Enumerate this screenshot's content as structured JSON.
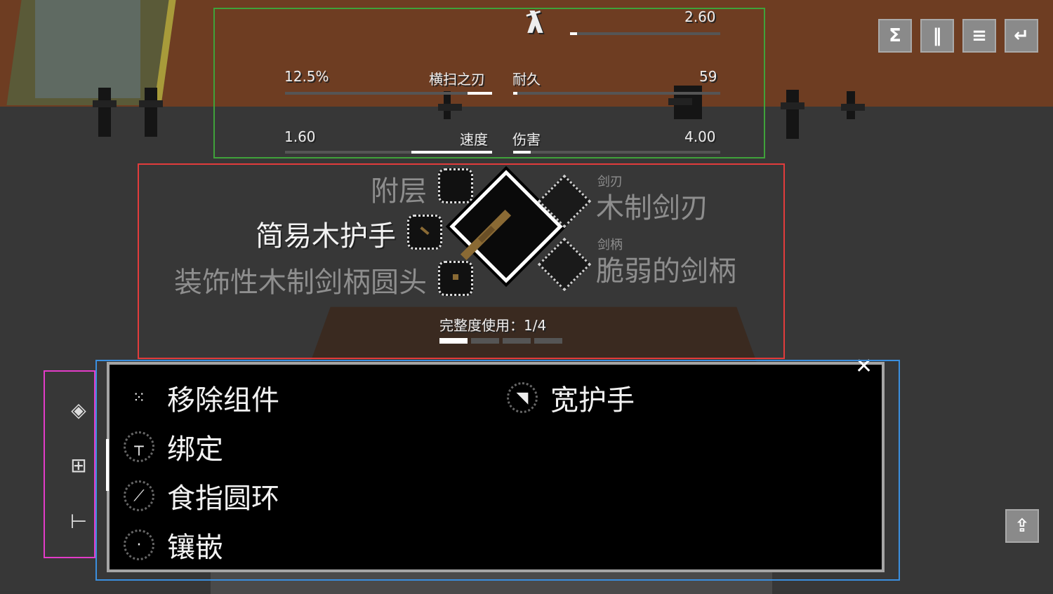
{
  "stats": {
    "top_value": "2.60",
    "sweep_percent": "12.5%",
    "sweep_label": "横扫之刃",
    "durability_label": "耐久",
    "durability_value": "59",
    "speed_value": "1.60",
    "speed_label": "速度",
    "damage_label": "伤害",
    "damage_value": "4.00"
  },
  "toolbar": {
    "icons": [
      "sort-icon",
      "pause-icon",
      "menu-icon",
      "return-icon"
    ],
    "glyphs": [
      "Σ",
      "‖",
      "≡",
      "↵"
    ]
  },
  "parts": {
    "layer_label": "附层",
    "guard_label": "简易木护手",
    "pommel_label": "装饰性木制剑柄圆头",
    "blade_category": "剑刃",
    "blade_label": "木制剑刃",
    "handle_category": "剑柄",
    "handle_label": "脆弱的剑柄",
    "integrity_text": "完整度使用：1/4",
    "integrity_used": 1,
    "integrity_total": 4
  },
  "options": {
    "remove": "移除组件",
    "wide_guard": "宽护手",
    "bind": "绑定",
    "finger_ring": "食指圆环",
    "inlay": "镶嵌"
  },
  "colors": {
    "accent": "#ffffff",
    "dim_text": "#8e8e8e",
    "wood": "#8a6a34"
  }
}
